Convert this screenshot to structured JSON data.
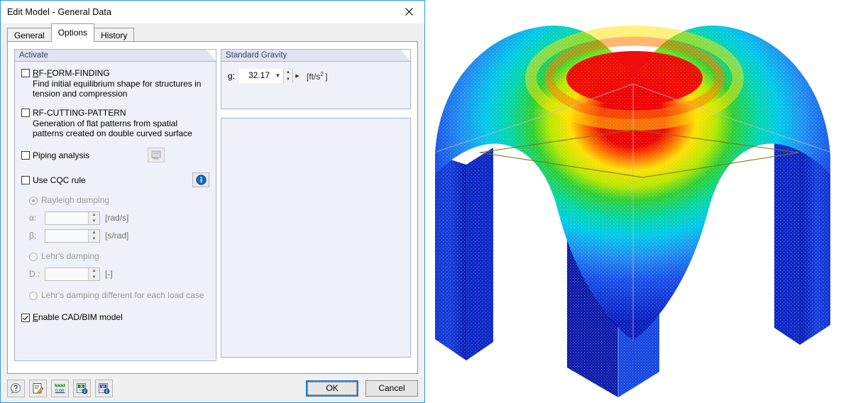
{
  "window": {
    "title": "Edit Model - General Data",
    "close_icon": "close-icon"
  },
  "tabs": [
    {
      "label": "General",
      "active": false
    },
    {
      "label": "Options",
      "active": true
    },
    {
      "label": "History",
      "active": false
    }
  ],
  "activate_group": {
    "caption": "Activate",
    "items": [
      {
        "label": "RF-FORM-FINDING",
        "accel": "F",
        "checked": false,
        "description": "Find initial equilibrium shape for structures in tension and compression"
      },
      {
        "label": "RF-CUTTING-PATTERN",
        "accel": "",
        "checked": false,
        "description": "Generation of flat patterns from spatial patterns created on double curved surface"
      }
    ],
    "piping": {
      "label": "Piping analysis",
      "checked": false,
      "button_icon": "piping-settings-icon",
      "button_enabled": false
    },
    "cqc": {
      "label": "Use CQC rule",
      "checked": false,
      "info_icon": "info-icon"
    },
    "damping": {
      "rayleigh": {
        "label": "Rayleigh damping",
        "selected": true,
        "enabled": false
      },
      "alpha": {
        "label": "α:",
        "value": "",
        "unit": "[rad/s]"
      },
      "beta": {
        "label": "β:",
        "value": "",
        "unit": "[s/rad]"
      },
      "lehr": {
        "label": "Lehr's damping",
        "selected": false,
        "enabled": false
      },
      "d": {
        "label": "D :",
        "value": "",
        "unit": "[-]"
      },
      "lehr_per_lc": {
        "label": "Lehr's damping different for each load case",
        "selected": false,
        "enabled": false
      }
    },
    "cadbim": {
      "label": "Enable CAD/BIM model",
      "accel": "E",
      "checked": true
    }
  },
  "gravity_group": {
    "caption": "Standard Gravity",
    "field_label": "g:",
    "field_accel": "g",
    "value": "32.17",
    "unit": "[ft/s²]",
    "chevron_icon": "chevron-down-icon",
    "spinner_icon": "spinner-icon",
    "more_icon": "arrow-right-icon"
  },
  "empty_panel": {
    "caption": ""
  },
  "toolbar": {
    "buttons": [
      {
        "name": "help-button",
        "icon": "help-icon"
      },
      {
        "name": "comment-button",
        "icon": "edit-note-icon"
      },
      {
        "name": "units-button",
        "icon": "units-icon"
      },
      {
        "name": "excel-export-button",
        "icon": "excel-icon"
      },
      {
        "name": "word-export-button",
        "icon": "word-icon"
      }
    ]
  },
  "footer": {
    "ok_label": "OK",
    "cancel_label": "Cancel"
  },
  "viewport": {
    "name": "fea-result-3d-view",
    "description": "Colored finite element mesh of a double-curved membrane canopy on four legs",
    "colors": {
      "peak": "#ee0000",
      "orange": "#ff8c00",
      "yellow": "#ffee00",
      "green": "#33cc33",
      "cyan": "#00dddd",
      "blue": "#1a50e8",
      "deep_blue": "#0b1fbe",
      "outline": "#7a7a12",
      "background": "#ffffff"
    }
  },
  "theme": {
    "accent": "#2e9be0",
    "group_border": "#a9b0d9",
    "group_bg": "#eef1f8",
    "dialog_bg": "#f0f0f0"
  }
}
